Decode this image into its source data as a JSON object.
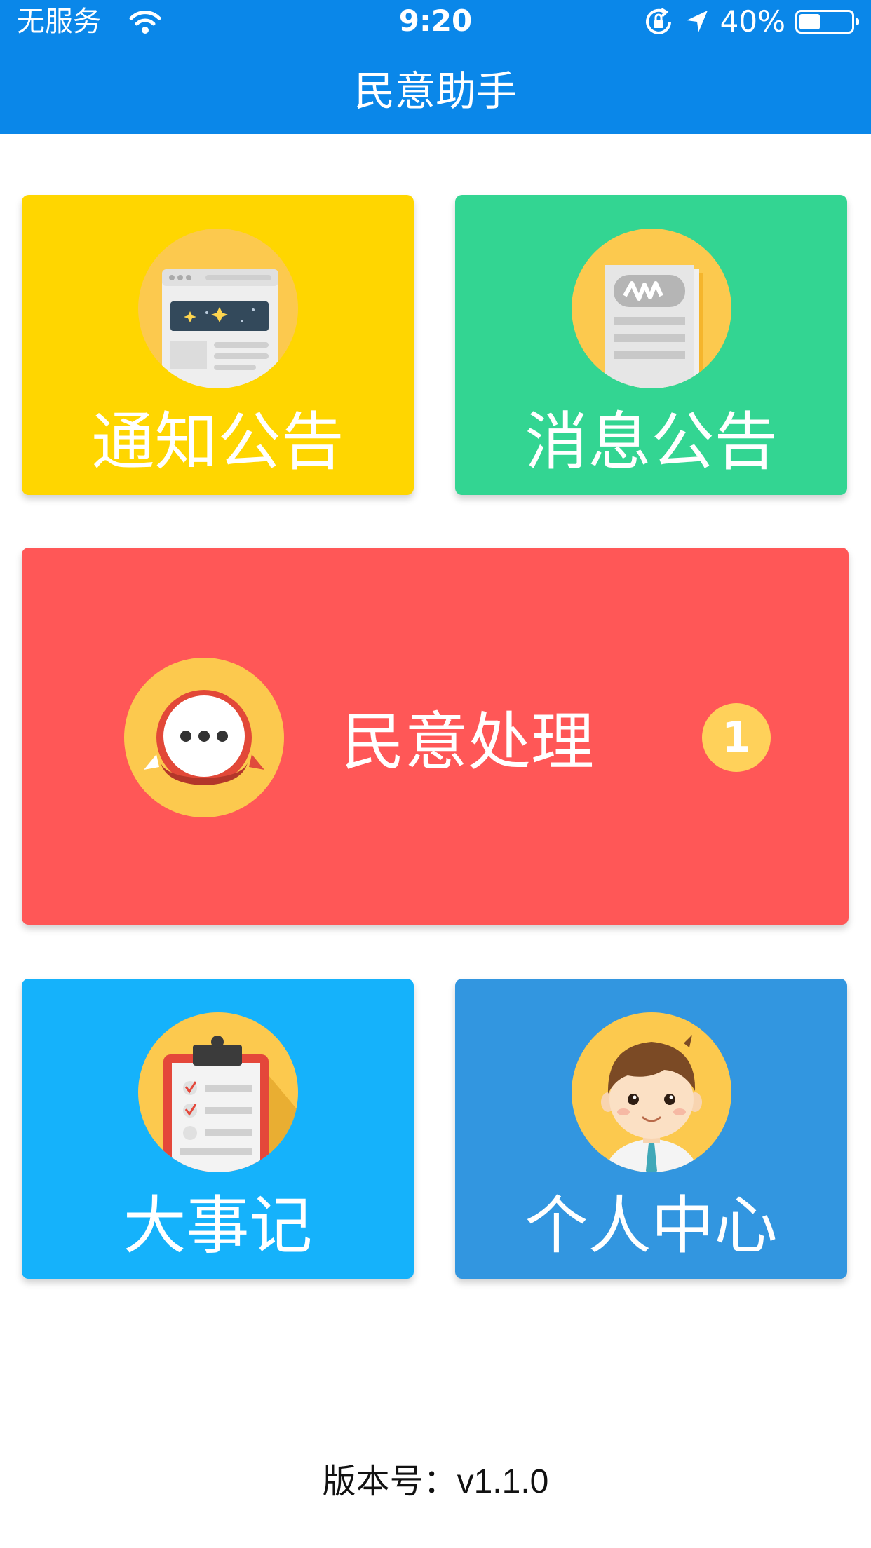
{
  "status_bar": {
    "carrier": "无服务",
    "time": "9:20",
    "battery_percent": "40%",
    "battery_level": 0.4
  },
  "nav": {
    "title": "民意助手"
  },
  "tiles": [
    {
      "label": "通知公告",
      "color": "#ffd600",
      "icon": "news-browser-icon"
    },
    {
      "label": "消息公告",
      "color": "#33d592",
      "icon": "newspaper-icon"
    },
    {
      "label": "民意处理",
      "color": "#ff5757",
      "icon": "chat-bubble-icon",
      "badge": "1"
    },
    {
      "label": "大事记",
      "color": "#15b2fb",
      "icon": "clipboard-checklist-icon"
    },
    {
      "label": "个人中心",
      "color": "#3296e0",
      "icon": "user-avatar-icon"
    }
  ],
  "footer": {
    "version": "版本号：v1.1.0"
  },
  "colors": {
    "topbar": "#0a87e9",
    "icon_circle": "#fcc94e",
    "badge": "#ffd15a"
  }
}
